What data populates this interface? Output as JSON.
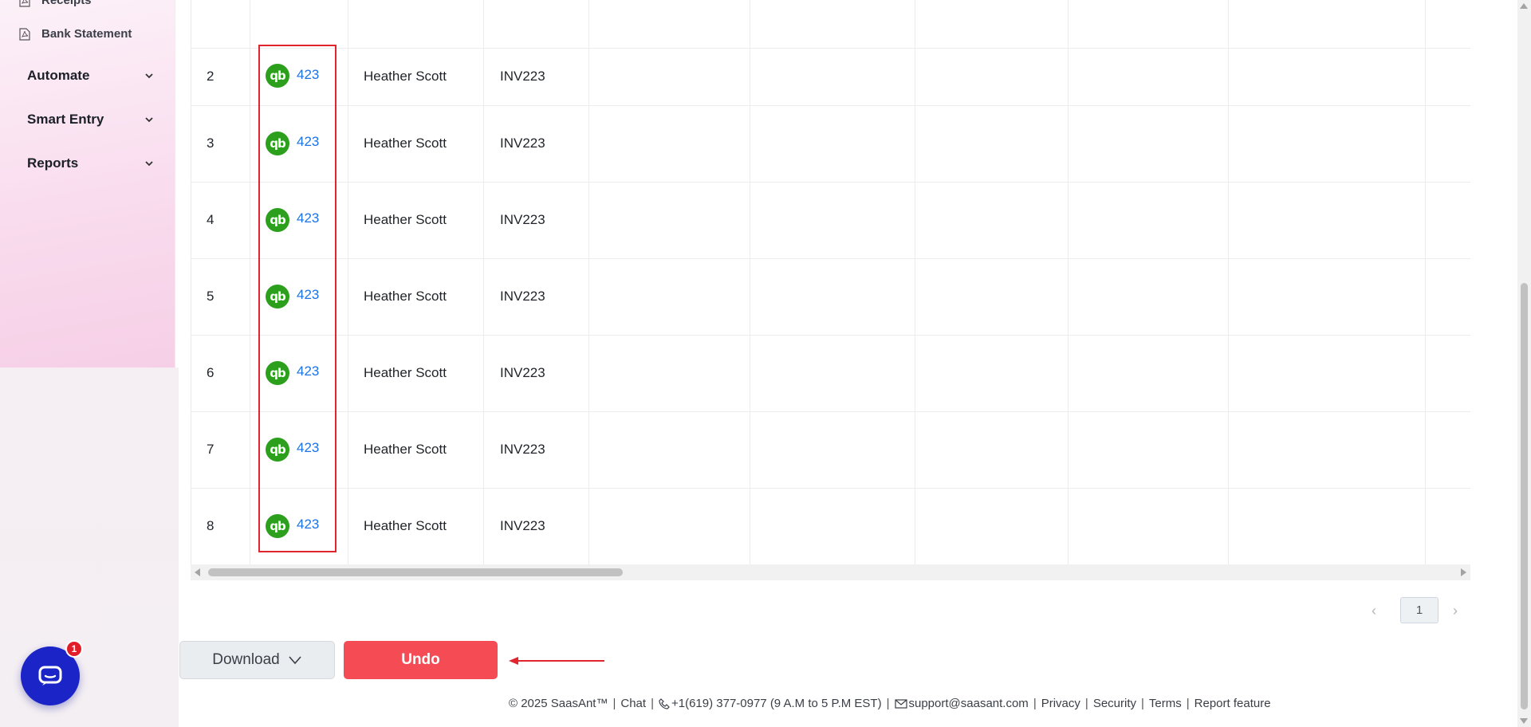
{
  "sidebar": {
    "sub_items": [
      {
        "label": "Receipts",
        "icon": "file-pdf-icon"
      },
      {
        "label": "Bank Statement",
        "icon": "file-pdf-icon"
      }
    ],
    "groups": [
      {
        "label": "Automate"
      },
      {
        "label": "Smart Entry"
      },
      {
        "label": "Reports"
      }
    ]
  },
  "table": {
    "rows": [
      {
        "num": "2",
        "link": "423",
        "name": "Heather Scott",
        "invoice": "INV223"
      },
      {
        "num": "3",
        "link": "423",
        "name": "Heather Scott",
        "invoice": "INV223"
      },
      {
        "num": "4",
        "link": "423",
        "name": "Heather Scott",
        "invoice": "INV223"
      },
      {
        "num": "5",
        "link": "423",
        "name": "Heather Scott",
        "invoice": "INV223"
      },
      {
        "num": "6",
        "link": "423",
        "name": "Heather Scott",
        "invoice": "INV223"
      },
      {
        "num": "7",
        "link": "423",
        "name": "Heather Scott",
        "invoice": "INV223"
      },
      {
        "num": "8",
        "link": "423",
        "name": "Heather Scott",
        "invoice": "INV223"
      }
    ],
    "qb_icon_text": "qb"
  },
  "pagination": {
    "current": "1",
    "prev": "‹",
    "next": "›"
  },
  "actions": {
    "download_label": "Download",
    "undo_label": "Undo"
  },
  "chat": {
    "badge": "1"
  },
  "footer": {
    "copyright": "© 2025 SaasAnt™",
    "chat": "Chat",
    "phone": "+1(619) 377-0977 (9 A.M to 5 P.M EST)",
    "email": "support@saasant.com",
    "privacy": "Privacy",
    "security": "Security",
    "terms": "Terms",
    "report": "Report feature"
  },
  "colors": {
    "accent_red": "#f54b55",
    "link_blue": "#1a73e8",
    "qb_green": "#2ca01c",
    "chat_blue": "#1b24c6"
  }
}
